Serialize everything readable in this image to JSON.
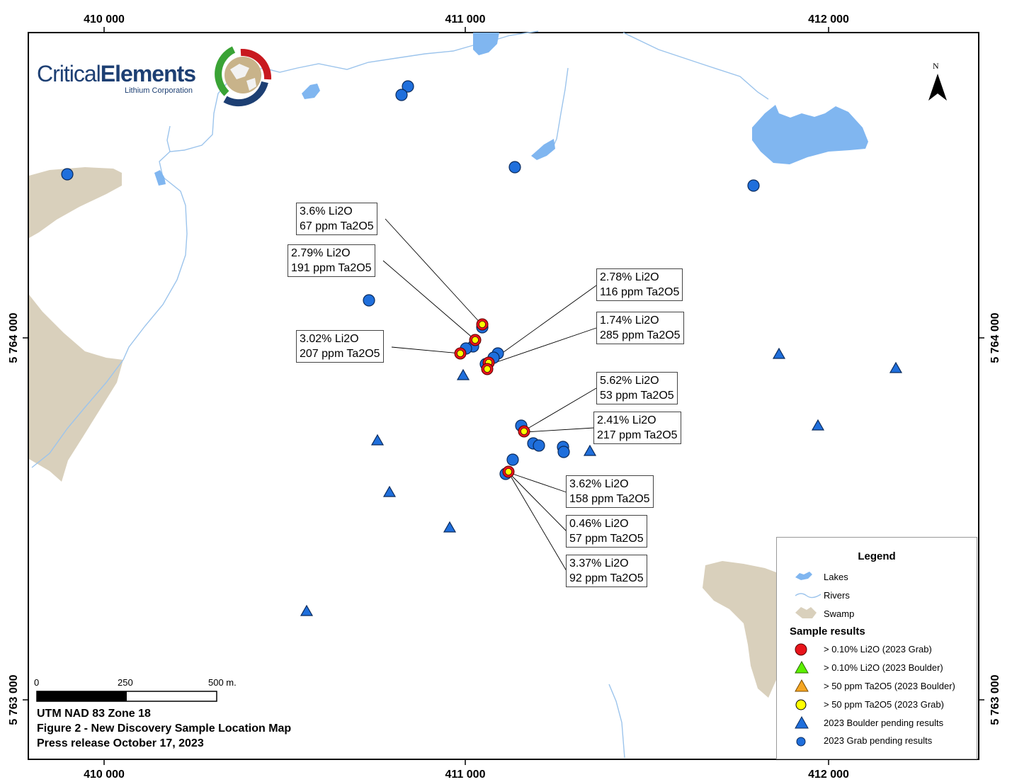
{
  "map": {
    "grid": {
      "x_labels": [
        "410 000",
        "411 000",
        "412 000"
      ],
      "y_labels": [
        "5 764 000",
        "5 763 000"
      ]
    },
    "colors": {
      "lake": "#80b6f0",
      "river": "#9cc4ec",
      "swamp": "#d9d0bc",
      "grab_pending": "#1f6fdc",
      "boulder_pending": "#1f6fdc",
      "li2o_grab": "#e8141b",
      "ta2o5_grab": "#ffff00",
      "li2o_boulder": "#5cf000",
      "ta2o5_boulder": "#f5a623"
    },
    "logo": {
      "word1": "Critical",
      "word2": "Elements",
      "sub": "Lithium Corporation"
    },
    "north": "N",
    "labels": [
      {
        "li": "3.6% Li2O",
        "ta": "67 ppm Ta2O5"
      },
      {
        "li": "2.79% Li2O",
        "ta": "191 ppm Ta2O5"
      },
      {
        "li": "2.78% Li2O",
        "ta": "116 ppm Ta2O5"
      },
      {
        "li": "1.74% Li2O",
        "ta": "285 ppm Ta2O5"
      },
      {
        "li": "3.02% Li2O",
        "ta": "207 ppm Ta2O5"
      },
      {
        "li": "5.62% Li2O",
        "ta": "53 ppm Ta2O5"
      },
      {
        "li": "2.41% Li2O",
        "ta": "217 ppm Ta2O5"
      },
      {
        "li": "3.62% Li2O",
        "ta": "158 ppm Ta2O5"
      },
      {
        "li": "0.46% Li2O",
        "ta": "57 ppm Ta2O5"
      },
      {
        "li": "3.37% Li2O",
        "ta": "92 ppm Ta2O5"
      }
    ],
    "scale": {
      "s0": "0",
      "s1": "250",
      "s2": "500 m."
    },
    "footer": {
      "line1": "UTM NAD 83 Zone 18",
      "line2": "Figure 2 - New Discovery Sample Location Map",
      "line3": "Press release October 17, 2023"
    }
  },
  "legend": {
    "title": "Legend",
    "lakes": "Lakes",
    "rivers": "Rivers",
    "swamp": "Swamp",
    "sample_results": "Sample results",
    "items": [
      "> 0.10% Li2O (2023 Grab)",
      "> 0.10% Li2O (2023 Boulder)",
      "> 50 ppm Ta2O5 (2023 Boulder)",
      "> 50 ppm Ta2O5 (2023 Grab)",
      "2023 Boulder pending results",
      "2023 Grab pending results"
    ]
  }
}
